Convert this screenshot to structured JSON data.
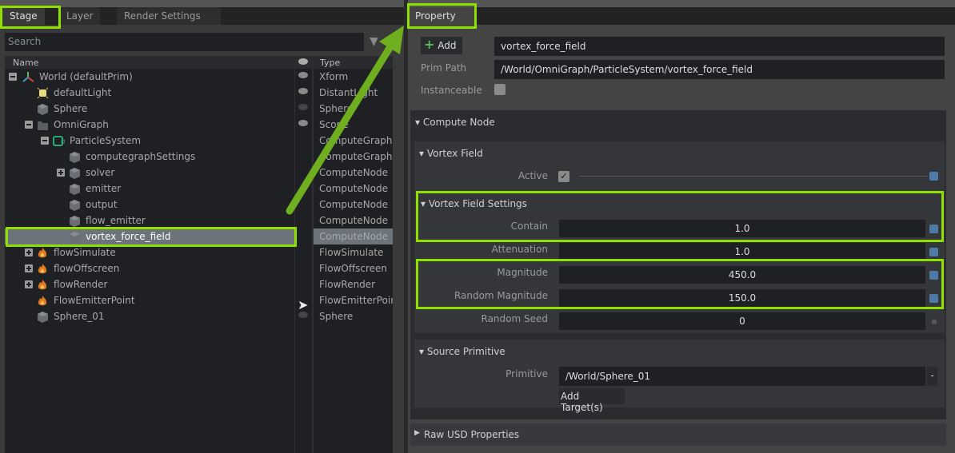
{
  "left_tabs": [
    "Stage",
    "Layer",
    "Render Settings"
  ],
  "search": {
    "placeholder": "Search"
  },
  "tree_header": {
    "name": "Name",
    "type": "Type"
  },
  "tree": [
    {
      "name": "World (defaultPrim)",
      "type": "Xform",
      "depth": 0,
      "expander": "minus",
      "icon": "xform-axes-icon",
      "visible": true
    },
    {
      "name": "defaultLight",
      "type": "DistantLight",
      "depth": 1,
      "icon": "light-icon",
      "visible": true
    },
    {
      "name": "Sphere",
      "type": "Sphere",
      "depth": 1,
      "icon": "cube-icon",
      "visible": false
    },
    {
      "name": "OmniGraph",
      "type": "Scope",
      "depth": 1,
      "expander": "minus",
      "icon": "folder-icon",
      "visible": true
    },
    {
      "name": "ParticleSystem",
      "type": "ComputeGraph",
      "depth": 2,
      "expander": "minus",
      "icon": "graph-icon"
    },
    {
      "name": "computegraphSettings",
      "type": "ComputeGraphSettings",
      "depth": 3,
      "icon": "cube-icon"
    },
    {
      "name": "solver",
      "type": "ComputeNode",
      "depth": 3,
      "expander": "plus",
      "icon": "cube-icon"
    },
    {
      "name": "emitter",
      "type": "ComputeNode",
      "depth": 3,
      "icon": "cube-icon"
    },
    {
      "name": "output",
      "type": "ComputeNode",
      "depth": 3,
      "icon": "cube-icon"
    },
    {
      "name": "flow_emitter",
      "type": "ComputeNode",
      "depth": 3,
      "icon": "cube-icon"
    },
    {
      "name": "vortex_force_field",
      "type": "ComputeNode",
      "depth": 3,
      "icon": "cube-icon",
      "selected": true
    },
    {
      "name": "flowSimulate",
      "type": "FlowSimulate",
      "depth": 1,
      "expander": "plus",
      "icon": "flame-icon"
    },
    {
      "name": "flowOffscreen",
      "type": "FlowOffscreen",
      "depth": 1,
      "expander": "plus",
      "icon": "flame-icon"
    },
    {
      "name": "flowRender",
      "type": "FlowRender",
      "depth": 1,
      "expander": "plus",
      "icon": "flame-icon"
    },
    {
      "name": "FlowEmitterPoint",
      "type": "FlowEmitterPoint",
      "depth": 1,
      "icon": "flame-icon"
    },
    {
      "name": "Sphere_01",
      "type": "Sphere",
      "depth": 1,
      "icon": "cube-icon",
      "visible": false
    }
  ],
  "property": {
    "tab": "Property",
    "add_label": "Add",
    "name_value": "vortex_force_field",
    "prim_path_label": "Prim Path",
    "prim_path_value": "/World/OmniGraph/ParticleSystem/vortex_force_field",
    "instanceable_label": "Instanceable",
    "instanceable": false,
    "compute_node": "Compute Node",
    "vortex_field": "Vortex Field",
    "active_label": "Active",
    "active": true,
    "settings": "Vortex Field Settings",
    "fields": [
      {
        "label": "Contain",
        "value": "1.0"
      },
      {
        "label": "Attenuation",
        "value": "1.0"
      },
      {
        "label": "Magnitude",
        "value": "450.0"
      },
      {
        "label": "Random Magnitude",
        "value": "150.0"
      },
      {
        "label": "Random Seed",
        "value": "0"
      }
    ],
    "source_primitive": "Source Primitive",
    "primitive_label": "Primitive",
    "primitive_value": "/World/Sphere_01",
    "remove_label": "-",
    "add_target": "Add Target(s)",
    "raw_usd": "Raw USD Properties"
  },
  "colors": {
    "highlight": "#8fe000",
    "accent": "#4d7aa6",
    "selection": "#6d737a"
  }
}
